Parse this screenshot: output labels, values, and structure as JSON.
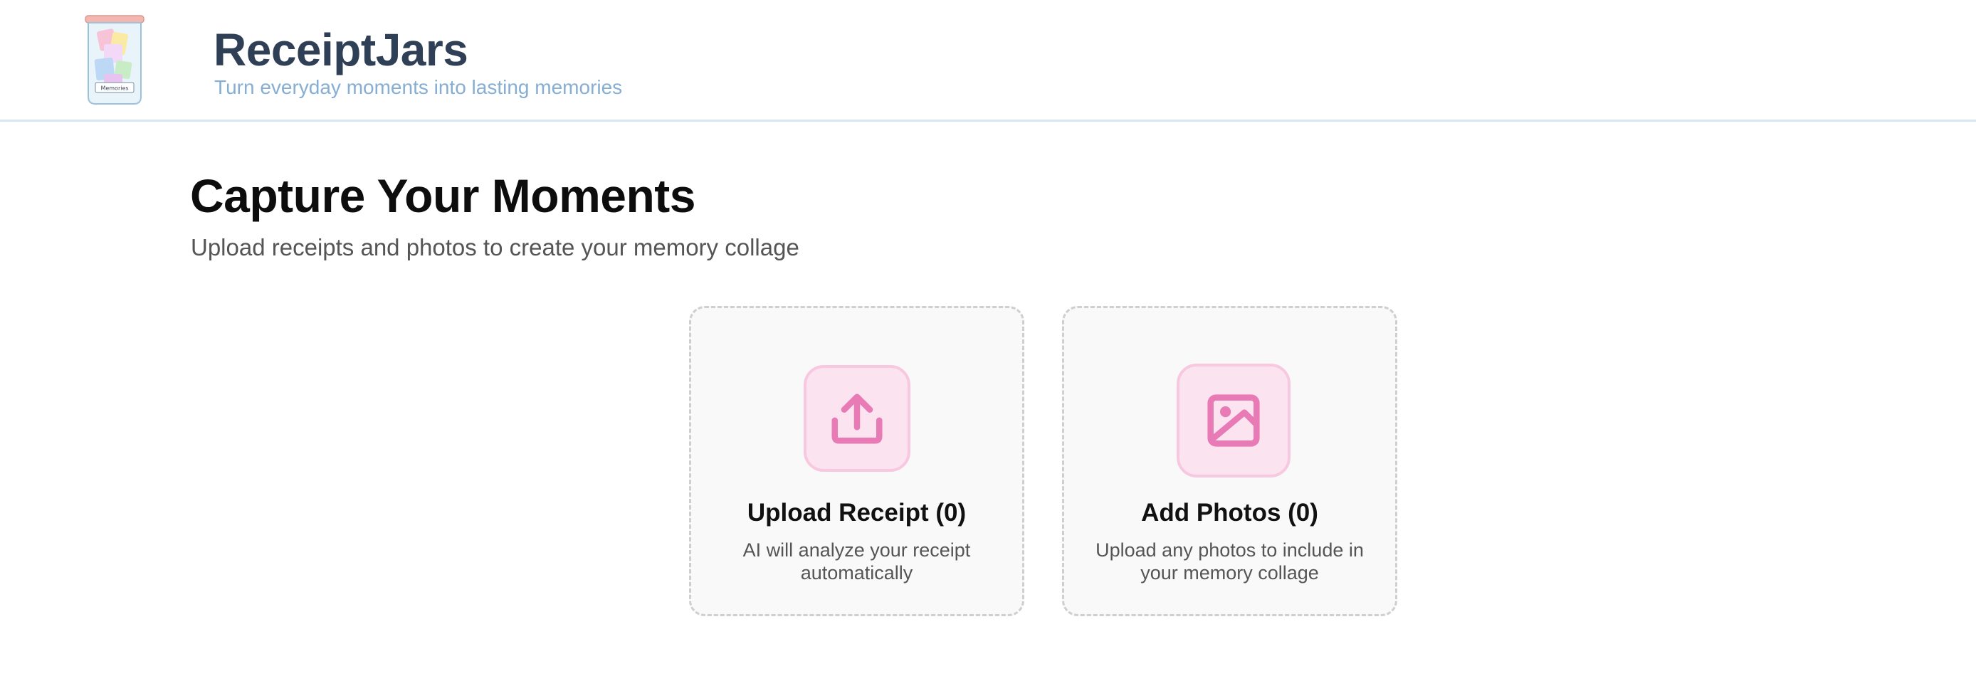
{
  "header": {
    "brand_title": "ReceiptJars",
    "tagline": "Turn everyday moments into lasting memories",
    "logo_label": "Memories",
    "colors": {
      "title": "#2f3f55",
      "tagline": "#86aed3",
      "divider": "#d6e6f2"
    }
  },
  "main": {
    "title": "Capture Your Moments",
    "subtitle": "Upload receipts and photos to create your memory collage",
    "cards": [
      {
        "title": "Upload Receipt (0)",
        "description": "AI will analyze your receipt automatically",
        "icon": "upload-icon"
      },
      {
        "title": "Add Photos (0)",
        "description": "Upload any photos to include in your memory collage",
        "icon": "image-icon"
      }
    ],
    "colors": {
      "accent": "#e87ab5",
      "icon_bg": "#fbe3f0",
      "card_border": "#cfcfcf",
      "card_bg": "#f9f9f9"
    }
  }
}
